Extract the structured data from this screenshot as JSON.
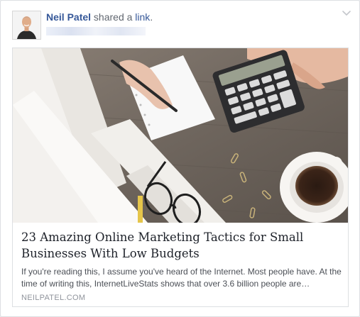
{
  "post": {
    "author": "Neil Patel",
    "action_text": " shared a ",
    "link_word": "link",
    "period": "."
  },
  "card": {
    "title": "23 Amazing Online Marketing Tactics for Small Businesses With Low Budgets",
    "description": "If you're reading this, I assume you've heard of the Internet. Most people have. At the time of writing this, InternetLiveStats shows that over 3.6 billion people are…",
    "domain": "NEILPATEL.COM"
  },
  "icons": {
    "options": "chevron-down-icon",
    "avatar": "author-avatar"
  },
  "colors": {
    "link_blue": "#365899",
    "meta_gray": "#90949c",
    "title_text": "#1d2129",
    "body_text": "#4b4f56",
    "border": "#dddfe2"
  }
}
